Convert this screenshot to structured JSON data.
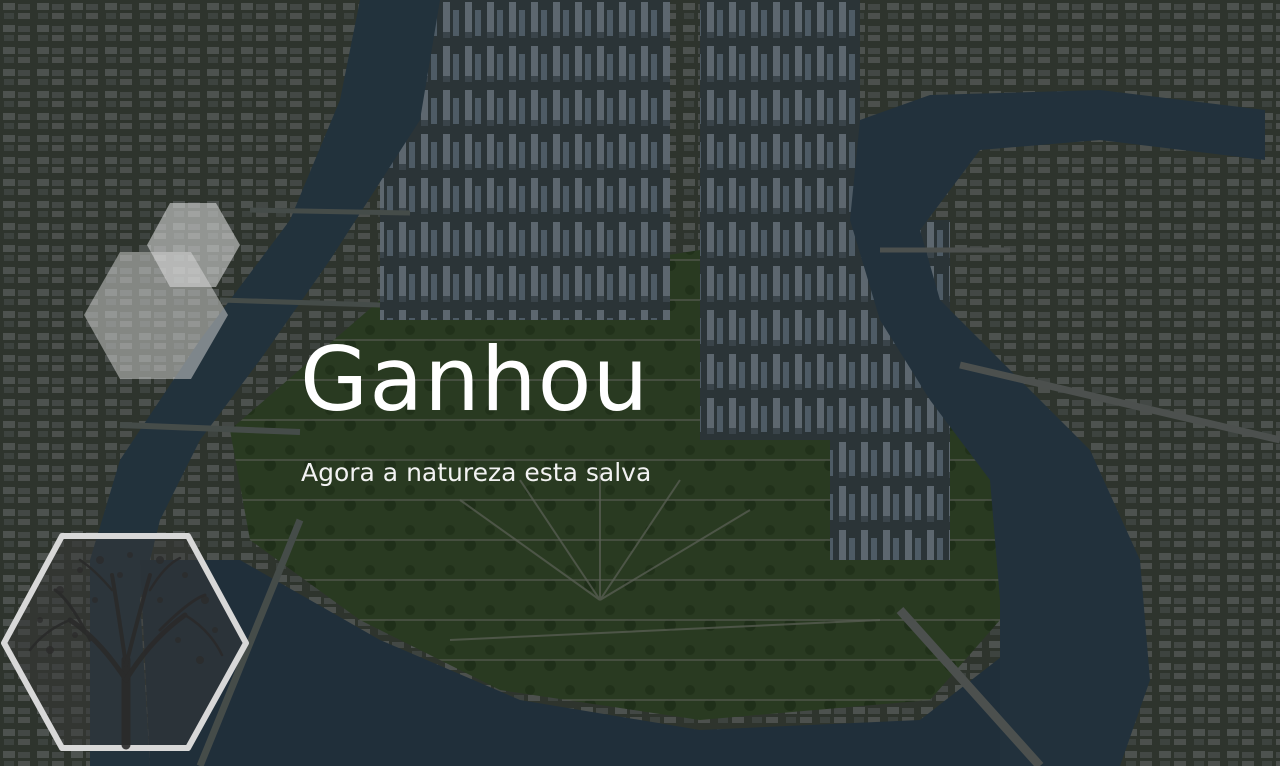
{
  "slide": {
    "title": "Ganhou",
    "subtitle": "Agora a natureza esta salva"
  },
  "background": {
    "description_icon": "aerial-city-river-image",
    "overlay_color": "#000000"
  },
  "decorations": {
    "hexagons": [
      "hexagon-small-icon",
      "hexagon-medium-icon"
    ],
    "tree_badge": "tree-hexagon-icon"
  },
  "colors": {
    "water": "#3d5a6e",
    "vegetation": "#3f5a36",
    "text": "#ffffff",
    "hex_fill": "#d8d8d8"
  }
}
